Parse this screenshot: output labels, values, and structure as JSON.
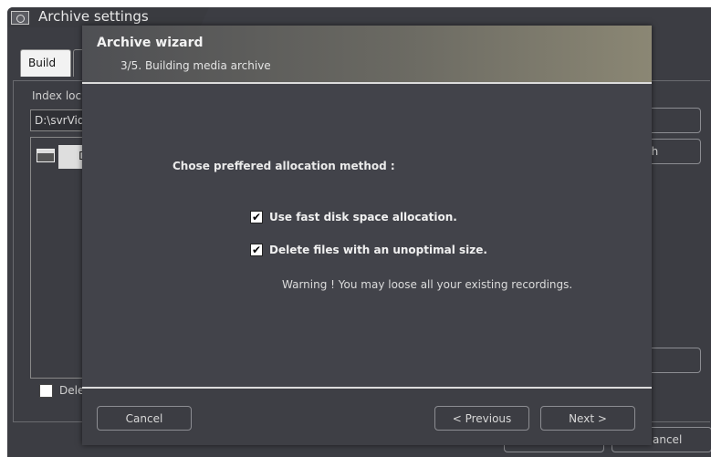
{
  "background_window": {
    "title": "Archive settings",
    "tabs": [
      "Build",
      ""
    ],
    "index_label": "Index loc",
    "index_value": "D:\\svrVid",
    "list_cell": "D",
    "delete_checkbox_label": "Dele",
    "button_search_fragment": "ch",
    "button_cancel_fragment": "ancel"
  },
  "wizard": {
    "title": "Archive wizard",
    "subtitle": "3/5. Building media archive",
    "heading": "Chose preffered allocation method :",
    "options": [
      {
        "label": "Use fast disk space allocation.",
        "checked": true
      },
      {
        "label": "Delete files with an unoptimal size.",
        "checked": true
      }
    ],
    "warning": "Warning ! You may loose all your existing recordings.",
    "buttons": {
      "cancel": "Cancel",
      "previous": "< Previous",
      "next": "Next >"
    }
  },
  "icons": {
    "window": "camera-window-icon",
    "check": "✔"
  }
}
